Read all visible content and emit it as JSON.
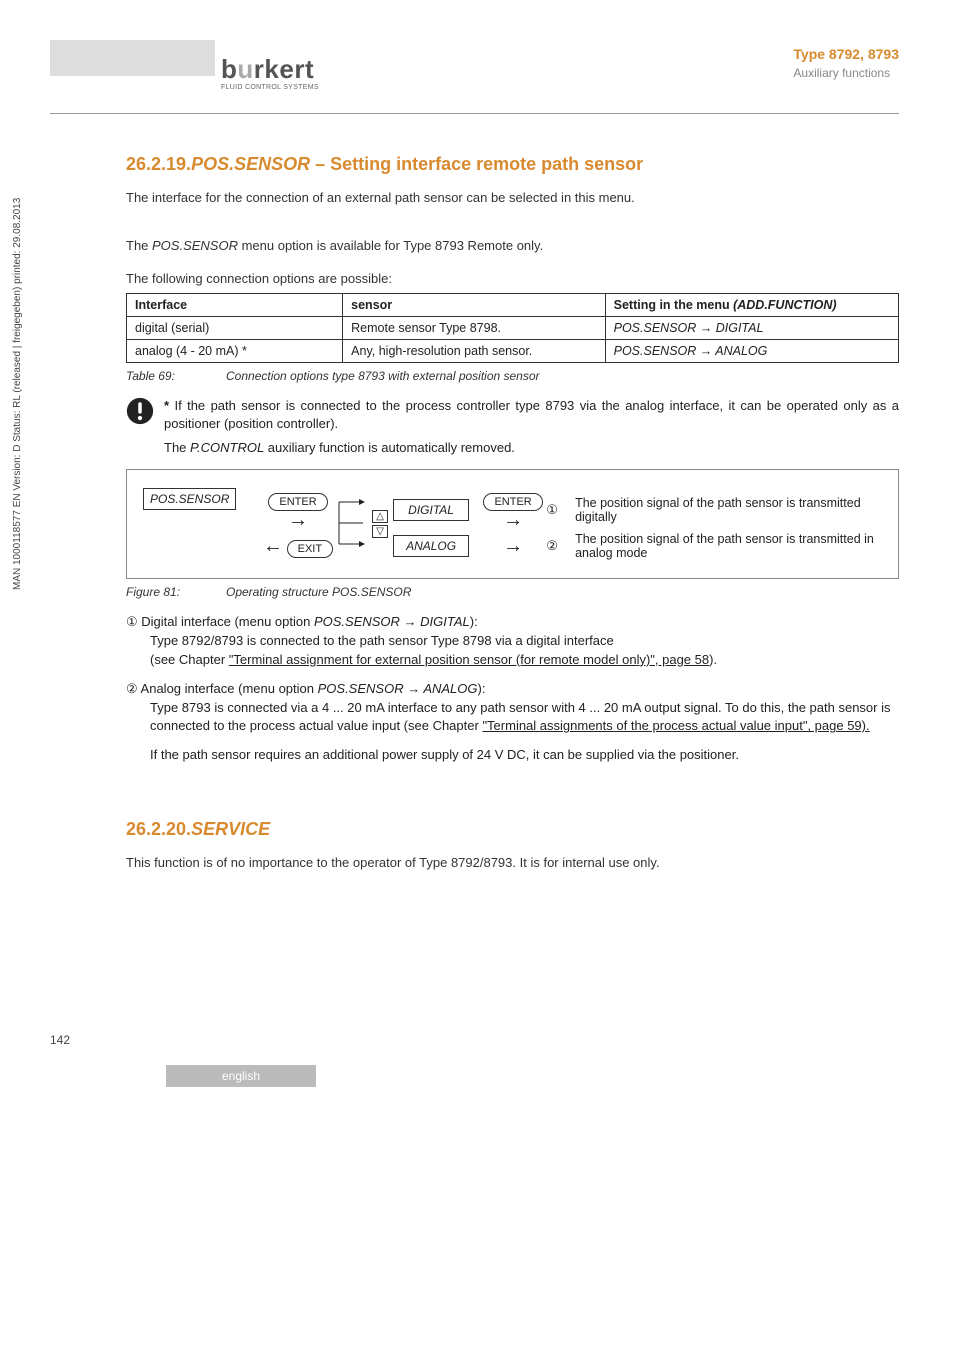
{
  "header": {
    "logo_text": "burkert",
    "logo_sub": "FLUID CONTROL SYSTEMS",
    "type_line": "Type 8792, 8793",
    "aux_line": "Auxiliary functions"
  },
  "vertical_text": "MAN 1000118577 EN Version: D Status: RL (released | freigegeben) printed: 29.08.2013",
  "page_number": "142",
  "section1": {
    "num": "26.2.19.",
    "keyword": "POS.SENSOR",
    "rest": " – Setting interface remote path sensor",
    "p1": "The interface for the connection of an external path sensor can be selected in this menu.",
    "p2a": "The ",
    "p2b": "POS.SENSOR",
    "p2c": " menu option is available for Type 8793 Remote only.",
    "p3": "The following connection options are possible:"
  },
  "table": {
    "h1": "Interface",
    "h2": "sensor",
    "h3a": "Setting in the menu ",
    "h3b": "(ADD.FUNCTION)",
    "r1c1": "digital (serial)",
    "r1c2": "Remote sensor Type 8798.",
    "r1c3": "POS.SENSOR → DIGITAL",
    "r2c1": "analog (4 - 20 mA) *",
    "r2c2": "Any, high-resolution path sensor.",
    "r2c3": "POS.SENSOR → ANALOG"
  },
  "table_caption": {
    "label": "Table 69:",
    "text": "Connection options type 8793 with external position sensor"
  },
  "note": {
    "star": "*",
    "text": "If the path sensor is connected to the process controller type 8793 via the analog interface, it can be operated only as a positioner (position controller).",
    "sub_a": "The ",
    "sub_b": "P.CONTROL",
    "sub_c": " auxiliary function is automatically removed."
  },
  "diagram": {
    "pos_sensor": "POS.SENSOR",
    "enter": "ENTER",
    "exit": "EXIT",
    "digital": "DIGITAL",
    "analog": "ANALOG",
    "n1": "①",
    "n2": "②",
    "desc1": "The position signal of the path sensor is transmitted digitally",
    "desc2": "The position signal of the path sensor is transmitted in analog mode"
  },
  "fig_caption": {
    "label": "Figure 81:",
    "text": "Operating structure POS.SENSOR"
  },
  "list": {
    "i1_num": "①",
    "i1_a": " Digital interface (menu option ",
    "i1_b": "POS.SENSOR → DIGITAL",
    "i1_c": "):",
    "i1_line2": "Type 8792/8793 is connected to the path sensor Type 8798 via a digital interface",
    "i1_line3a": "(see Chapter ",
    "i1_line3b": "\"Terminal assignment for external position sensor (for remote model only)\", page 58",
    "i1_line3c": ").",
    "i2_num": "②",
    "i2_a": " Analog interface (menu option ",
    "i2_b": "POS.SENSOR → ANALOG",
    "i2_c": "):",
    "i2_line2a": "Type 8793 is connected via a 4 ... 20 mA interface to any path sensor with 4 ... 20 mA output signal. To do this, the path sensor is connected to the process actual value input (see Chapter ",
    "i2_line2b": "\"Terminal assignments of the process actual value input\", page 59).",
    "i2_line3": "If the path sensor requires an additional power supply of 24 V DC, it can be supplied via the positioner."
  },
  "section2": {
    "num": "26.2.20.",
    "keyword": "SERVICE",
    "p1": "This function is of no importance to the operator of Type 8792/8793. It is for internal use only."
  },
  "lang": "english"
}
